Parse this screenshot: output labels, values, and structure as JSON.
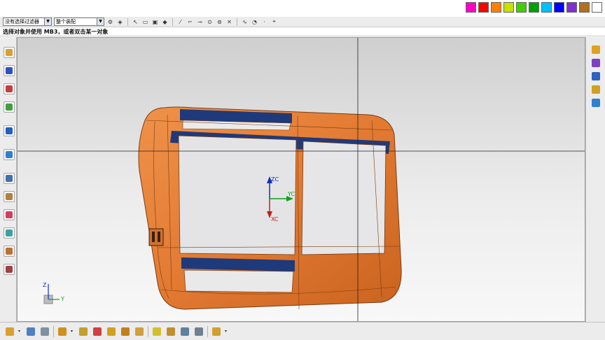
{
  "palette": [
    "#ff00cc",
    "#ff0000",
    "#ff8000",
    "#c8e000",
    "#40d000",
    "#00a000",
    "#00c0ff",
    "#0000ff",
    "#8030d0",
    "#b07020",
    "#ffffff"
  ],
  "selection_bar": {
    "type_filter": "没有选择过滤器",
    "scope": "整个装配",
    "icons": [
      "filter-options-icon",
      "snap-point-icon",
      "cursor-icon",
      "rectangle-select-icon",
      "selection-box-icon",
      "solid-body-icon",
      "line-icon",
      "end-point-icon",
      "mid-point-icon",
      "control-point-icon",
      "arc-center-icon",
      "intersection-icon",
      "point-on-curve-icon",
      "quadrant-icon",
      "existing-point-icon",
      "nearest-icon"
    ]
  },
  "cue_line": "选择对象并使用 MB3，或者双击某一对象",
  "viewport": {
    "colors": {
      "part": "#e8823a",
      "part_edge": "#7a3a10",
      "inner": "#1f3a7a",
      "crosshair": "#222222"
    },
    "wcs": {
      "z_label": "ZC",
      "y_label": "YC",
      "x_label": "XC"
    },
    "triad": {
      "z_label": "Z",
      "y_label": "Y"
    }
  },
  "left_toolbar": {
    "buttons": [
      {
        "name": "assembly-navigator-icon",
        "color": "#d8a030"
      },
      {
        "name": "constraint-navigator-icon",
        "color": "#3050c0"
      },
      {
        "name": "part-navigator-icon",
        "color": "#c04040"
      },
      {
        "name": "reuse-library-icon",
        "color": "#40a040"
      },
      {
        "name": "web-browser-icon",
        "color": "#2060c0"
      },
      {
        "name": "history-icon",
        "color": "#3080d0"
      },
      {
        "name": "clock-icon",
        "color": "#4070b0"
      },
      {
        "name": "system-materials-icon",
        "color": "#b08040"
      },
      {
        "name": "process-studio-icon",
        "color": "#d04060"
      },
      {
        "name": "manufacturing-wizards-icon",
        "color": "#40a0a0"
      },
      {
        "name": "roles-icon",
        "color": "#c07030"
      },
      {
        "name": "system-scenes-icon",
        "color": "#a04040"
      }
    ]
  },
  "right_toolbar": {
    "buttons": [
      {
        "name": "view-cube-icon",
        "color": "#e0a020"
      },
      {
        "name": "orient-view-icon",
        "color": "#8040c0"
      },
      {
        "name": "layer-icon",
        "color": "#3060c0"
      },
      {
        "name": "show-hide-icon",
        "color": "#d0a020"
      },
      {
        "name": "section-view-icon",
        "color": "#3080d0"
      }
    ]
  },
  "bottom_toolbar": {
    "buttons": [
      {
        "name": "assembly-constraint-icon",
        "color": "#d8a030"
      },
      {
        "name": "component-icon",
        "color": "#5080c0"
      },
      {
        "name": "new-component-icon",
        "color": "#8090a0"
      },
      {
        "name": "add-component-icon",
        "color": "#d09020"
      },
      {
        "name": "move-component-icon",
        "color": "#c0a030"
      },
      {
        "name": "mate-component-icon",
        "color": "#d04040"
      },
      {
        "name": "reposition-icon",
        "color": "#d0a020"
      },
      {
        "name": "array-component-icon",
        "color": "#c08020"
      },
      {
        "name": "replace-component-icon",
        "color": "#d0a040"
      },
      {
        "name": "exploded-view-icon",
        "color": "#d0c030"
      },
      {
        "name": "wave-link-icon",
        "color": "#c09030"
      },
      {
        "name": "clearance-icon",
        "color": "#6080a0"
      },
      {
        "name": "sequence-icon",
        "color": "#708090"
      },
      {
        "name": "arrangements-icon",
        "color": "#d0a030"
      }
    ]
  }
}
